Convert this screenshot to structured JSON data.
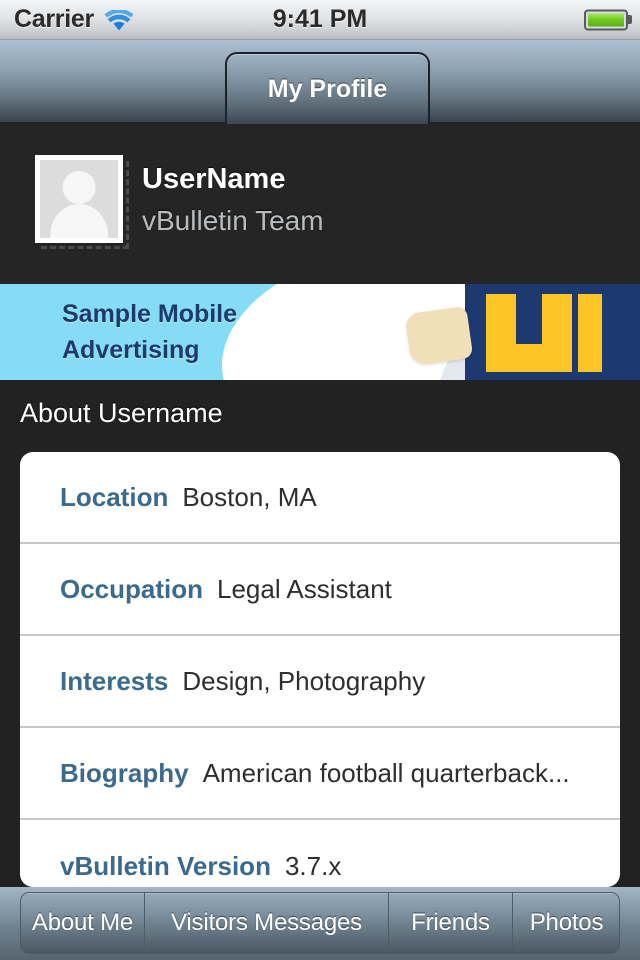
{
  "status_bar": {
    "carrier": "Carrier",
    "time": "9:41 PM",
    "wifi_icon": "wifi-icon",
    "battery_icon": "battery-icon",
    "battery_level_percent": 100,
    "wifi_color": "#1e7fd4",
    "battery_color": "#6fc61f"
  },
  "nav_bar": {
    "tab_label": "My Profile"
  },
  "profile": {
    "avatar_icon": "avatar-placeholder-icon",
    "username": "UserName",
    "usertitle": "vBulletin Team"
  },
  "ad_banner": {
    "line1": "Sample Mobile",
    "line2": "Advertising",
    "background_color": "#87dcf5",
    "text_color": "#1e3a6b",
    "logo_navy": "#1c3a70",
    "logo_yellow": "#fcc424"
  },
  "section": {
    "title": "About Username"
  },
  "info_rows": [
    {
      "label": "Location",
      "value": "Boston, MA"
    },
    {
      "label": "Occupation",
      "value": "Legal Assistant"
    },
    {
      "label": "Interests",
      "value": "Design, Photography"
    },
    {
      "label": "Biography",
      "value": "American football quarterback..."
    },
    {
      "label": "vBulletin Version",
      "value": "3.7.x"
    }
  ],
  "tab_bar": {
    "items": [
      {
        "label": "About Me"
      },
      {
        "label": "Visitors Messages"
      },
      {
        "label": "Friends"
      },
      {
        "label": "Photos"
      }
    ]
  },
  "colors": {
    "label_blue": "#3b6a8f",
    "page_background": "#222222",
    "card_background": "#ffffff",
    "separator": "#c8c8c8"
  }
}
